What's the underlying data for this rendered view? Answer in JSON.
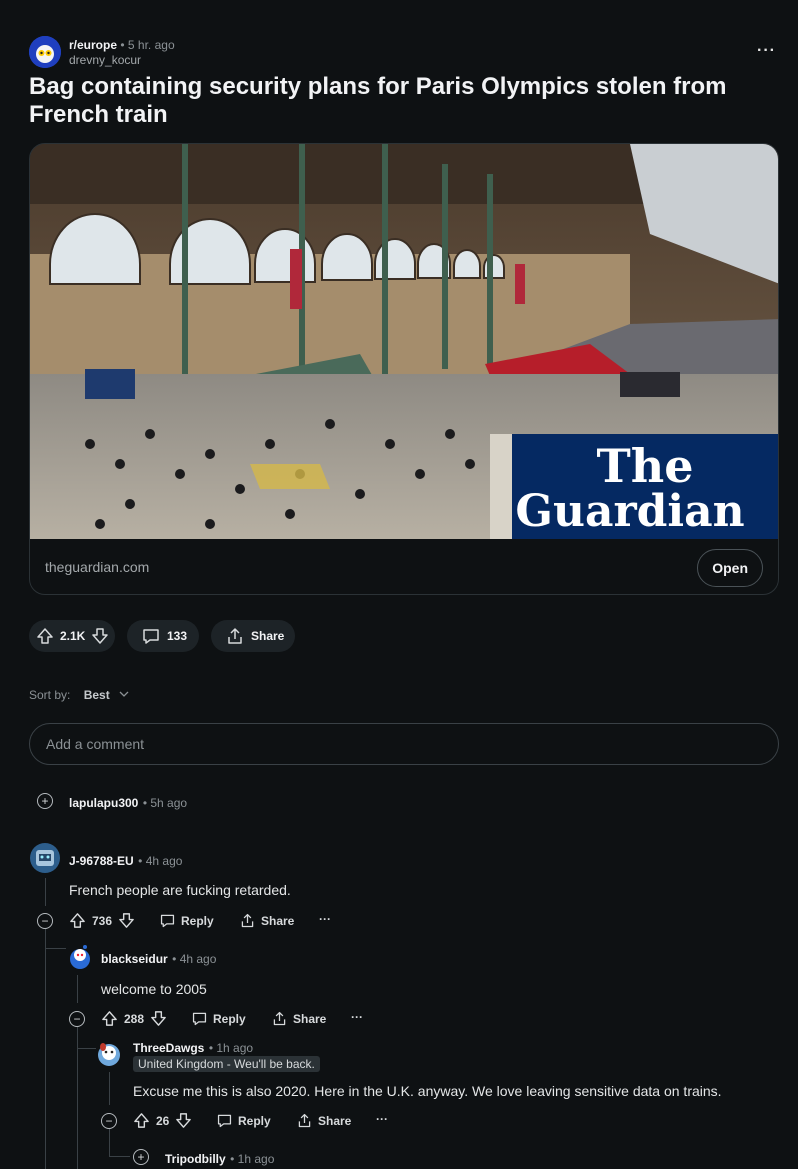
{
  "post": {
    "subreddit": "r/europe",
    "time": "5 hr. ago",
    "author": "drevny_kocur",
    "title": "Bag containing security plans for Paris Olympics stolen from French train",
    "link_domain": "theguardian.com",
    "open_label": "Open",
    "image_logo_line1": "The",
    "image_logo_line2": "Guardian",
    "votes": "2.1K",
    "comments": "133",
    "share_label": "Share"
  },
  "sort": {
    "label": "Sort by:",
    "value": "Best"
  },
  "add_comment_placeholder": "Add a comment",
  "comments": [
    {
      "user": "lapulapu300",
      "time": "5h ago"
    },
    {
      "user": "J-96788-EU",
      "time": "4h ago",
      "text": "French people are fucking retarded.",
      "votes": "736",
      "reply": "Reply",
      "share": "Share",
      "more": "···"
    },
    {
      "user": "blackseidur",
      "time": "4h ago",
      "text": "welcome to 2005",
      "votes": "288",
      "reply": "Reply",
      "share": "Share",
      "more": "···"
    },
    {
      "user": "ThreeDawgs",
      "time": "1h ago",
      "flair": "United Kingdom - Weu'll be back.",
      "text": "Excuse me this is also 2020. Here in the U.K. anyway. We love leaving sensitive data on trains.",
      "votes": "26",
      "reply": "Reply",
      "share": "Share",
      "more": "···"
    },
    {
      "user": "Tripodbilly",
      "time": "1h ago"
    }
  ],
  "colors": {
    "background": "#0e1113",
    "pill": "#1d2327",
    "guardian_blue": "#052962"
  },
  "icons": [
    "subreddit-icon",
    "upvote-icon",
    "downvote-icon",
    "comment-icon",
    "share-icon",
    "plus-circle-icon",
    "minus-circle-icon",
    "chevron-down-icon"
  ]
}
